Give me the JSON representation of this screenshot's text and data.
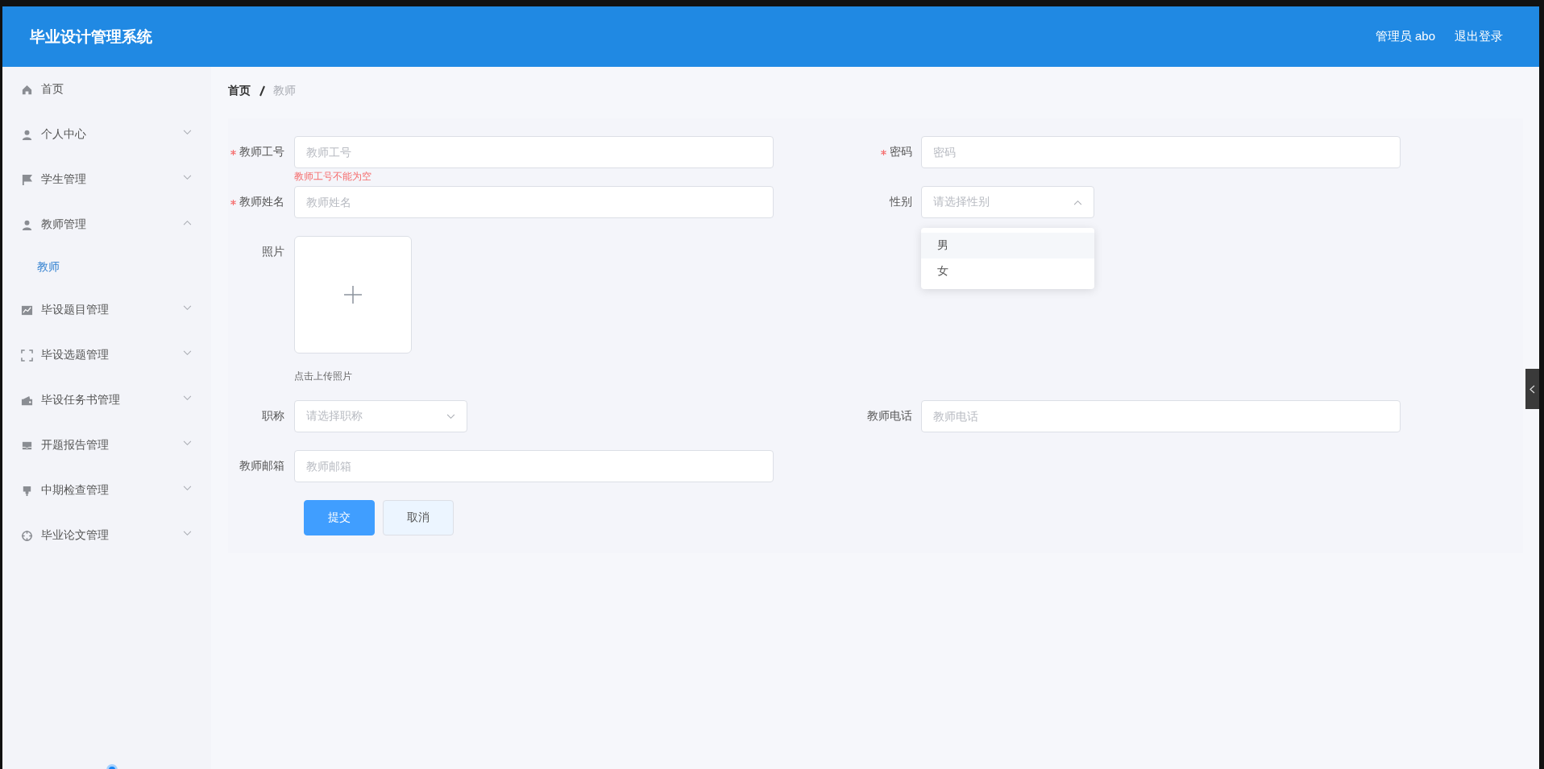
{
  "header": {
    "title": "毕业设计管理系统",
    "user": "管理员 abo",
    "logout": "退出登录"
  },
  "sidebar": {
    "items": [
      {
        "label": "首页",
        "kind": "link"
      },
      {
        "label": "个人中心",
        "kind": "submenu",
        "expanded": false
      },
      {
        "label": "学生管理",
        "kind": "submenu",
        "expanded": false
      },
      {
        "label": "教师管理",
        "kind": "submenu",
        "expanded": true,
        "children": [
          {
            "label": "教师",
            "selected": true
          }
        ]
      },
      {
        "label": "毕设题目管理",
        "kind": "submenu",
        "expanded": false
      },
      {
        "label": "毕设选题管理",
        "kind": "submenu",
        "expanded": false
      },
      {
        "label": "毕设任务书管理",
        "kind": "submenu",
        "expanded": false
      },
      {
        "label": "开题报告管理",
        "kind": "submenu",
        "expanded": false
      },
      {
        "label": "中期检查管理",
        "kind": "submenu",
        "expanded": false
      },
      {
        "label": "毕业论文管理",
        "kind": "submenu",
        "expanded": false
      }
    ]
  },
  "breadcrumb": [
    {
      "label": "首页"
    },
    {
      "label": "教师"
    }
  ],
  "form": {
    "rows": [
      {
        "fields": [
          {
            "kind": "text",
            "label": "教师工号",
            "placeholder": "教师工号",
            "required": true,
            "error": "教师工号不能为空"
          },
          {
            "kind": "text",
            "label": "密码",
            "placeholder": "密码",
            "required": true
          }
        ]
      },
      {
        "fields": [
          {
            "kind": "text",
            "label": "教师姓名",
            "placeholder": "教师姓名",
            "required": true
          },
          {
            "kind": "select",
            "label": "性别",
            "placeholder": "请选择性别",
            "open": true,
            "options": [
              {
                "label": "男",
                "hovered": true
              },
              {
                "label": "女",
                "hovered": false
              }
            ]
          }
        ]
      },
      {
        "fields": [
          {
            "kind": "upload",
            "label": "照片",
            "hint": "点击上传照片"
          }
        ]
      },
      {
        "fields": [
          {
            "kind": "select",
            "label": "职称",
            "placeholder": "请选择职称",
            "open": false
          },
          {
            "kind": "text",
            "label": "教师电话",
            "placeholder": "教师电话"
          }
        ]
      },
      {
        "fields": [
          {
            "kind": "text",
            "label": "教师邮箱",
            "placeholder": "教师邮箱"
          }
        ]
      }
    ],
    "buttons": [
      {
        "label": "提交",
        "kind": "primary"
      },
      {
        "label": "取消",
        "kind": "default"
      }
    ]
  }
}
